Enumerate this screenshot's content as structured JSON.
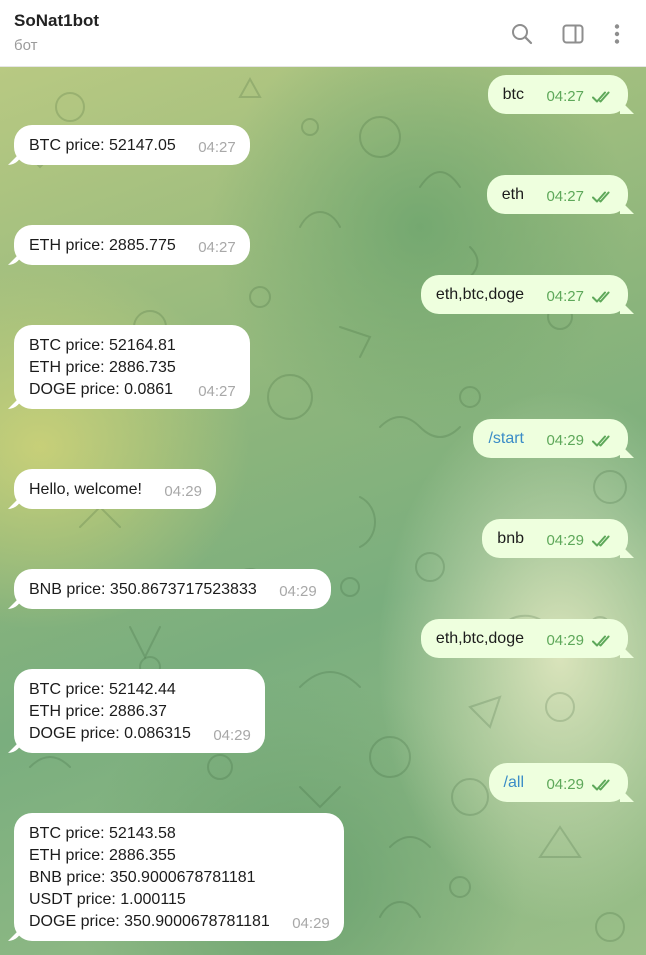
{
  "header": {
    "title": "SoNat1bot",
    "subtitle": "бот",
    "search_icon": "search-icon",
    "sidebar_icon": "sidebar-toggle-icon",
    "menu_icon": "more-vertical-icon"
  },
  "colors": {
    "incoming_bubble": "#ffffff",
    "outgoing_bubble": "#eeffde",
    "outgoing_time": "#5ea85a",
    "incoming_time": "#a8a8a8",
    "command_link": "#3a8cc7"
  },
  "messages": [
    {
      "dir": "out",
      "text": "btc",
      "time": "04:27",
      "read": true
    },
    {
      "dir": "in",
      "text": "BTC price: 52147.05",
      "time": "04:27"
    },
    {
      "dir": "out",
      "text": "eth",
      "time": "04:27",
      "read": true
    },
    {
      "dir": "in",
      "text": "ETH price: 2885.775",
      "time": "04:27"
    },
    {
      "dir": "out",
      "text": "eth,btc,doge",
      "time": "04:27",
      "read": true
    },
    {
      "dir": "in",
      "text": "BTC price: 52164.81\nETH price: 2886.735\nDOGE price: 0.0861",
      "time": "04:27"
    },
    {
      "dir": "out",
      "text": "/start",
      "time": "04:29",
      "read": true,
      "command": true
    },
    {
      "dir": "in",
      "text": "Hello, welcome!",
      "time": "04:29"
    },
    {
      "dir": "out",
      "text": "bnb",
      "time": "04:29",
      "read": true
    },
    {
      "dir": "in",
      "text": "BNB price: 350.8673717523833",
      "time": "04:29"
    },
    {
      "dir": "out",
      "text": "eth,btc,doge",
      "time": "04:29",
      "read": true
    },
    {
      "dir": "in",
      "text": "BTC price: 52142.44\nETH price: 2886.37\nDOGE price: 0.086315",
      "time": "04:29"
    },
    {
      "dir": "out",
      "text": "/all",
      "time": "04:29",
      "read": true,
      "command": true
    },
    {
      "dir": "in",
      "text": "BTC price: 52143.58\nETH price: 2886.355\nBNB price: 350.9000678781181\nUSDT price: 1.000115\nDOGE price: 350.9000678781181",
      "time": "04:29"
    }
  ]
}
